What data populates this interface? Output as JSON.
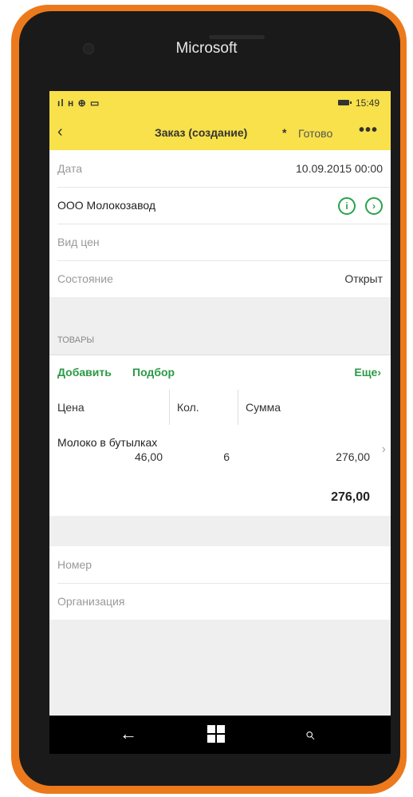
{
  "device": {
    "brand": "Microsoft"
  },
  "status_bar": {
    "left": "ıl н ⊕ ▭",
    "time": "15:49"
  },
  "title_bar": {
    "back_icon": "back-arrow-icon",
    "title": "Заказ (создание)",
    "modified_mark": "*",
    "done": "Готово",
    "more": "•••"
  },
  "form": {
    "date_label": "Дата",
    "date_value": "10.09.2015 00:00",
    "counterparty": "ООО Молокозавод",
    "info_icon": "i",
    "open_icon": "›",
    "price_type_placeholder": "Вид цен",
    "state_label": "Состояние",
    "state_value": "Открыт"
  },
  "goods": {
    "section_title": "ТОВАРЫ",
    "add": "Добавить",
    "select": "Подбор",
    "more": "Еще",
    "more_icon": "›",
    "columns": [
      "Цена",
      "Кол.",
      "Сумма"
    ],
    "rows": [
      {
        "name": "Молоко в бутылках",
        "price": "46,00",
        "qty": "6",
        "sum": "276,00"
      }
    ],
    "total": "276,00"
  },
  "extra": {
    "number_placeholder": "Номер",
    "organization_placeholder": "Организация"
  },
  "nav": {
    "back": "←",
    "search": "⌕"
  },
  "colors": {
    "accent_yellow": "#f8e14a",
    "link_green": "#2a9a46",
    "phone_orange": "#ec7a1c"
  }
}
